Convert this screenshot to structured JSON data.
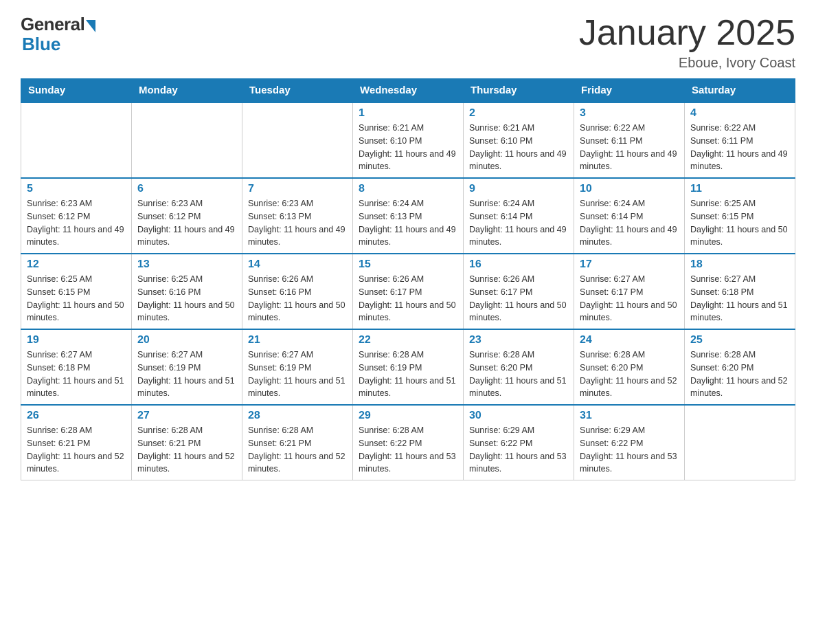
{
  "logo": {
    "general": "General",
    "blue": "Blue"
  },
  "title": "January 2025",
  "location": "Eboue, Ivory Coast",
  "days_of_week": [
    "Sunday",
    "Monday",
    "Tuesday",
    "Wednesday",
    "Thursday",
    "Friday",
    "Saturday"
  ],
  "weeks": [
    [
      null,
      null,
      null,
      {
        "day": 1,
        "sunrise": "6:21 AM",
        "sunset": "6:10 PM",
        "daylight": "11 hours and 49 minutes."
      },
      {
        "day": 2,
        "sunrise": "6:21 AM",
        "sunset": "6:10 PM",
        "daylight": "11 hours and 49 minutes."
      },
      {
        "day": 3,
        "sunrise": "6:22 AM",
        "sunset": "6:11 PM",
        "daylight": "11 hours and 49 minutes."
      },
      {
        "day": 4,
        "sunrise": "6:22 AM",
        "sunset": "6:11 PM",
        "daylight": "11 hours and 49 minutes."
      }
    ],
    [
      {
        "day": 5,
        "sunrise": "6:23 AM",
        "sunset": "6:12 PM",
        "daylight": "11 hours and 49 minutes."
      },
      {
        "day": 6,
        "sunrise": "6:23 AM",
        "sunset": "6:12 PM",
        "daylight": "11 hours and 49 minutes."
      },
      {
        "day": 7,
        "sunrise": "6:23 AM",
        "sunset": "6:13 PM",
        "daylight": "11 hours and 49 minutes."
      },
      {
        "day": 8,
        "sunrise": "6:24 AM",
        "sunset": "6:13 PM",
        "daylight": "11 hours and 49 minutes."
      },
      {
        "day": 9,
        "sunrise": "6:24 AM",
        "sunset": "6:14 PM",
        "daylight": "11 hours and 49 minutes."
      },
      {
        "day": 10,
        "sunrise": "6:24 AM",
        "sunset": "6:14 PM",
        "daylight": "11 hours and 49 minutes."
      },
      {
        "day": 11,
        "sunrise": "6:25 AM",
        "sunset": "6:15 PM",
        "daylight": "11 hours and 50 minutes."
      }
    ],
    [
      {
        "day": 12,
        "sunrise": "6:25 AM",
        "sunset": "6:15 PM",
        "daylight": "11 hours and 50 minutes."
      },
      {
        "day": 13,
        "sunrise": "6:25 AM",
        "sunset": "6:16 PM",
        "daylight": "11 hours and 50 minutes."
      },
      {
        "day": 14,
        "sunrise": "6:26 AM",
        "sunset": "6:16 PM",
        "daylight": "11 hours and 50 minutes."
      },
      {
        "day": 15,
        "sunrise": "6:26 AM",
        "sunset": "6:17 PM",
        "daylight": "11 hours and 50 minutes."
      },
      {
        "day": 16,
        "sunrise": "6:26 AM",
        "sunset": "6:17 PM",
        "daylight": "11 hours and 50 minutes."
      },
      {
        "day": 17,
        "sunrise": "6:27 AM",
        "sunset": "6:17 PM",
        "daylight": "11 hours and 50 minutes."
      },
      {
        "day": 18,
        "sunrise": "6:27 AM",
        "sunset": "6:18 PM",
        "daylight": "11 hours and 51 minutes."
      }
    ],
    [
      {
        "day": 19,
        "sunrise": "6:27 AM",
        "sunset": "6:18 PM",
        "daylight": "11 hours and 51 minutes."
      },
      {
        "day": 20,
        "sunrise": "6:27 AM",
        "sunset": "6:19 PM",
        "daylight": "11 hours and 51 minutes."
      },
      {
        "day": 21,
        "sunrise": "6:27 AM",
        "sunset": "6:19 PM",
        "daylight": "11 hours and 51 minutes."
      },
      {
        "day": 22,
        "sunrise": "6:28 AM",
        "sunset": "6:19 PM",
        "daylight": "11 hours and 51 minutes."
      },
      {
        "day": 23,
        "sunrise": "6:28 AM",
        "sunset": "6:20 PM",
        "daylight": "11 hours and 51 minutes."
      },
      {
        "day": 24,
        "sunrise": "6:28 AM",
        "sunset": "6:20 PM",
        "daylight": "11 hours and 52 minutes."
      },
      {
        "day": 25,
        "sunrise": "6:28 AM",
        "sunset": "6:20 PM",
        "daylight": "11 hours and 52 minutes."
      }
    ],
    [
      {
        "day": 26,
        "sunrise": "6:28 AM",
        "sunset": "6:21 PM",
        "daylight": "11 hours and 52 minutes."
      },
      {
        "day": 27,
        "sunrise": "6:28 AM",
        "sunset": "6:21 PM",
        "daylight": "11 hours and 52 minutes."
      },
      {
        "day": 28,
        "sunrise": "6:28 AM",
        "sunset": "6:21 PM",
        "daylight": "11 hours and 52 minutes."
      },
      {
        "day": 29,
        "sunrise": "6:28 AM",
        "sunset": "6:22 PM",
        "daylight": "11 hours and 53 minutes."
      },
      {
        "day": 30,
        "sunrise": "6:29 AM",
        "sunset": "6:22 PM",
        "daylight": "11 hours and 53 minutes."
      },
      {
        "day": 31,
        "sunrise": "6:29 AM",
        "sunset": "6:22 PM",
        "daylight": "11 hours and 53 minutes."
      },
      null
    ]
  ]
}
